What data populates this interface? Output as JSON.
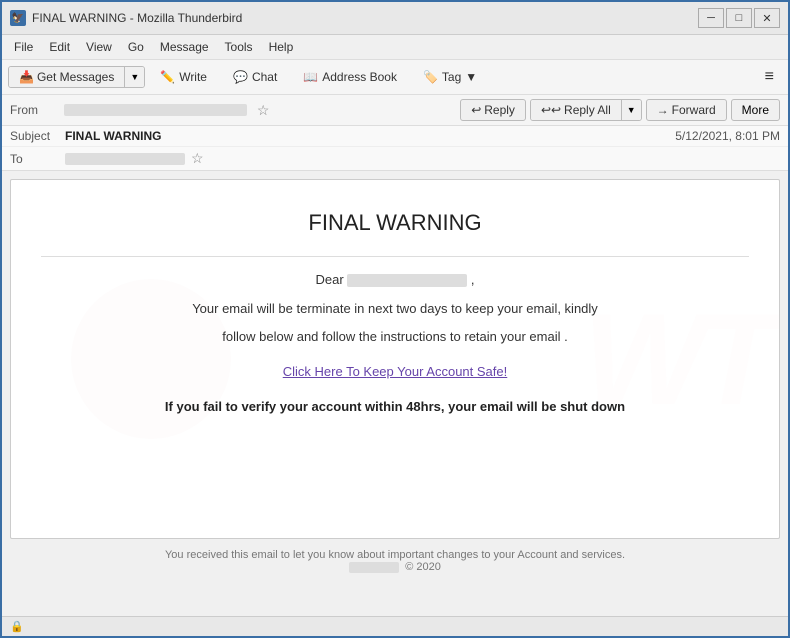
{
  "window": {
    "title": "FINAL WARNING - Mozilla Thunderbird",
    "icon": "🦅"
  },
  "title_controls": {
    "minimize": "─",
    "maximize": "□",
    "close": "✕"
  },
  "menu": {
    "items": [
      "File",
      "Edit",
      "View",
      "Go",
      "Message",
      "Tools",
      "Help"
    ]
  },
  "toolbar": {
    "get_messages_label": "Get Messages",
    "write_label": "Write",
    "chat_label": "Chat",
    "address_book_label": "Address Book",
    "tag_label": "Tag"
  },
  "action_bar": {
    "reply_label": "Reply",
    "reply_all_label": "Reply All",
    "forward_label": "Forward",
    "more_label": "More"
  },
  "email_header": {
    "from_label": "From",
    "subject_label": "Subject",
    "subject_value": "FINAL WARNING",
    "date_value": "5/12/2021, 8:01 PM",
    "to_label": "To"
  },
  "email_body": {
    "title": "FINAL WARNING",
    "dear_label": "Dear",
    "paragraph1": "Your email will be terminate in next two days to keep your email, kindly",
    "paragraph2": "follow below and follow the instructions to retain your email .",
    "link_text": "Click Here To Keep Your Account Safe!",
    "warning_text": "If you fail to verify your account within 48hrs, your email will be shut down",
    "footer_text": "You received this email to let you know about important changes to your Account and services.",
    "footer_year": "© 2020"
  },
  "status_bar": {
    "icon": "🔒"
  }
}
